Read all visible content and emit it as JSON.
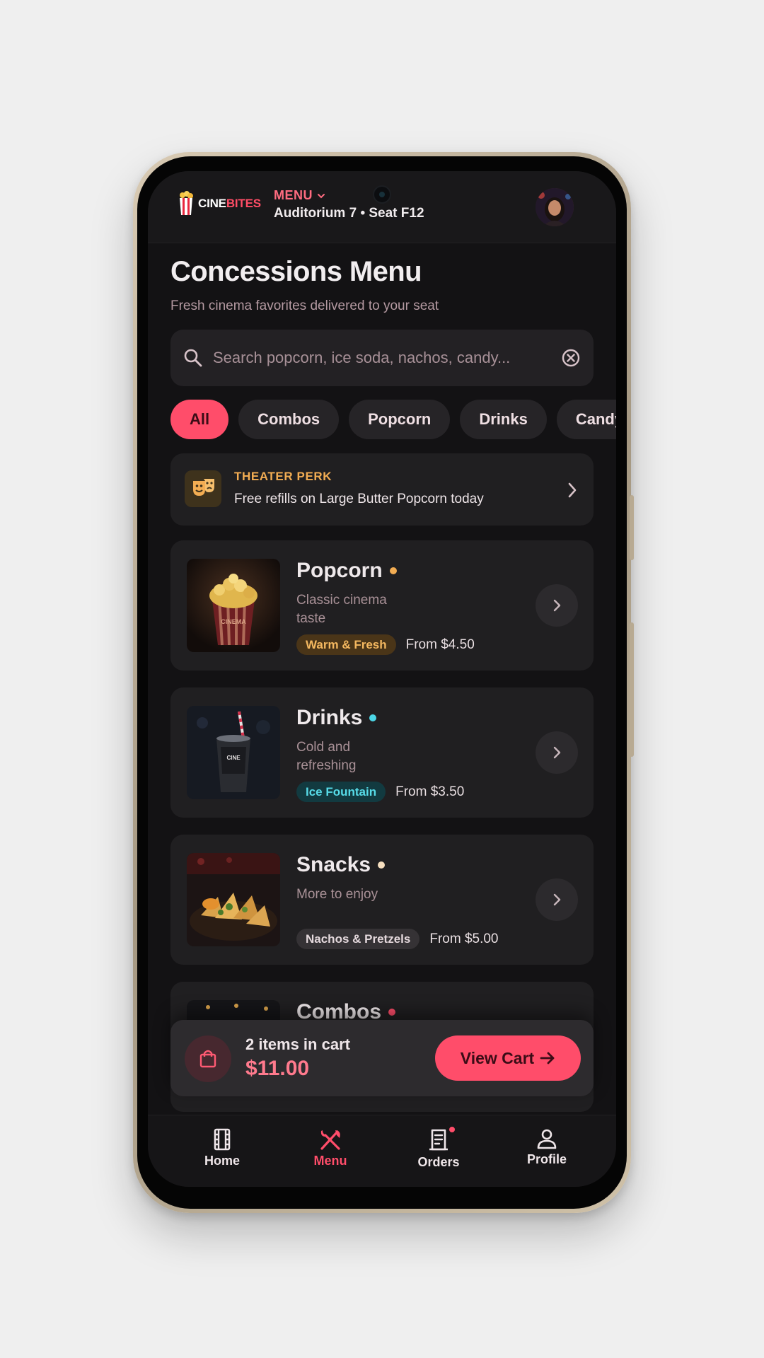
{
  "app": {
    "logo_part1": "CINE",
    "logo_part2": "BITES",
    "menu_label": "MENU",
    "location": "Auditorium 7 • Seat F12"
  },
  "header": {
    "title": "Concessions Menu",
    "subtitle": "Fresh cinema favorites delivered to your seat"
  },
  "search": {
    "placeholder": "Search popcorn, ice soda, nachos, candy..."
  },
  "chips": [
    "All",
    "Combos",
    "Popcorn",
    "Drinks",
    "Candy"
  ],
  "perk": {
    "label": "THEATER PERK",
    "text": "Free refills on Large Butter Popcorn today"
  },
  "categories": [
    {
      "name": "Popcorn",
      "desc": "Classic cinema taste",
      "badge": "Warm & Fresh",
      "price": "From $4.50",
      "dot_color": "#f3ad53",
      "badge_bg": "#4a3518",
      "badge_fg": "#f4b860"
    },
    {
      "name": "Drinks",
      "desc": "Cold and refreshing",
      "badge": "Ice Fountain",
      "price": "From $3.50",
      "dot_color": "#4cd6e6",
      "badge_bg": "#123a40",
      "badge_fg": "#57dbe8"
    },
    {
      "name": "Snacks",
      "desc": "More to enjoy",
      "badge": "Nachos & Pretzels",
      "price": "From $5.00",
      "dot_color": "#f6dfbf",
      "badge_bg": "#353235",
      "badge_fg": "#e4d8dc"
    },
    {
      "name": "Combos",
      "dot_color": "#ff4d6a"
    }
  ],
  "cart": {
    "count_text": "2 items in cart",
    "total": "$11.00",
    "button": "View Cart"
  },
  "nav": {
    "items": [
      "Home",
      "Menu",
      "Orders",
      "Profile"
    ],
    "active": "Menu"
  },
  "colors": {
    "accent": "#ff4d6a",
    "background": "#131214",
    "surface": "#201f21"
  }
}
